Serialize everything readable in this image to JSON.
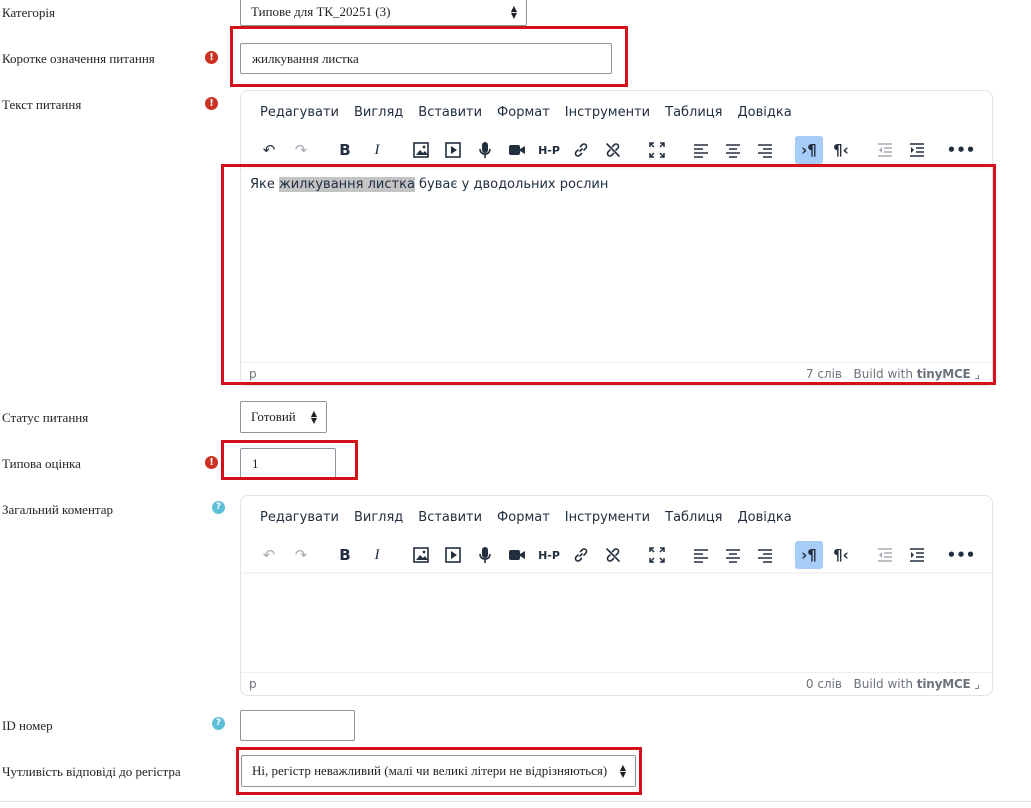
{
  "form": {
    "category": {
      "label": "Категорія",
      "value": "Типове для ТК_20251 (3)"
    },
    "short_name": {
      "label": "Коротке означення питання",
      "value": "жилкування листка"
    },
    "question_text": {
      "label": "Текст питання",
      "content_before": "Яке ",
      "content_highlight": "жилкування листка",
      "content_after": " буває у дводольних рослин",
      "path": "p",
      "word_count": "7 слів"
    },
    "status": {
      "label": "Статус питання",
      "value": "Готовий"
    },
    "default_mark": {
      "label": "Типова оцінка",
      "value": "1"
    },
    "general_feedback": {
      "label": "Загальний коментар",
      "path": "p",
      "word_count": "0 слів"
    },
    "id_number": {
      "label": "ID номер",
      "value": ""
    },
    "case_sensitivity": {
      "label": "Чутливість відповіді до регістра",
      "value": "Ні, регістр неважливий (малі чи великі літери не відрізняються)"
    }
  },
  "editor": {
    "menu": [
      "Редагувати",
      "Вигляд",
      "Вставити",
      "Формат",
      "Інструменти",
      "Таблиця",
      "Довідка"
    ],
    "branding_prefix": "Build with",
    "branding_name": "tinyMCE"
  },
  "icons": {
    "required": "exclamation-circle-icon",
    "help": "question-circle-icon"
  },
  "colors": {
    "required": "#ca3120",
    "help": "#5ebfd8",
    "annotation_box": "#d4111a",
    "toggle_active": "#a6ccf7"
  }
}
